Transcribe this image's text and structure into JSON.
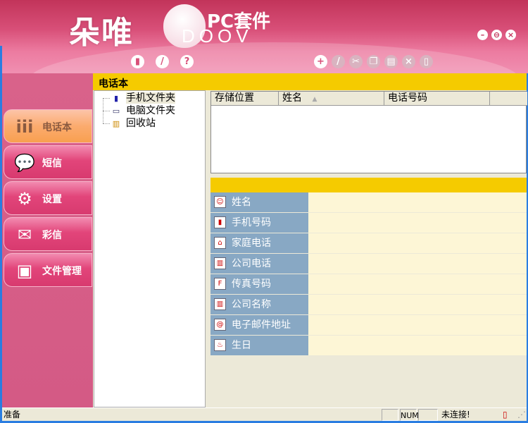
{
  "header": {
    "logo_cn": "朵唯",
    "logo_suffix": "PC套件",
    "logo_brand": "DOOV",
    "window_controls": [
      "minimize",
      "restore",
      "close"
    ],
    "toolbar_left": [
      {
        "icon": "new-icon",
        "glyph": "▮"
      },
      {
        "icon": "edit-icon",
        "glyph": "/"
      },
      {
        "icon": "help-icon",
        "glyph": "?"
      }
    ],
    "toolbar_right": [
      {
        "icon": "add-icon",
        "glyph": "+",
        "enabled": true
      },
      {
        "icon": "edit-icon",
        "glyph": "/",
        "enabled": false
      },
      {
        "icon": "cut-icon",
        "glyph": "✂",
        "enabled": false
      },
      {
        "icon": "copy-icon",
        "glyph": "❐",
        "enabled": false
      },
      {
        "icon": "paste-icon",
        "glyph": "▤",
        "enabled": false
      },
      {
        "icon": "delete-icon",
        "glyph": "×",
        "enabled": false
      },
      {
        "icon": "export-icon",
        "glyph": "▯",
        "enabled": false
      }
    ]
  },
  "sidebar": {
    "items": [
      {
        "label": "电话本",
        "icon": "contacts-icon",
        "glyph": "iii",
        "active": true
      },
      {
        "label": "短信",
        "icon": "sms-icon",
        "glyph": "💬"
      },
      {
        "label": "设置",
        "icon": "settings-icon",
        "glyph": "⚙"
      },
      {
        "label": "彩信",
        "icon": "mms-icon",
        "glyph": "✉"
      },
      {
        "label": "文件管理",
        "icon": "file-manager-icon",
        "glyph": "▣"
      }
    ]
  },
  "panel_title": "电话本",
  "tree": [
    {
      "label": "手机文件夹",
      "icon": "phone-icon",
      "glyph": "▮",
      "selected": true
    },
    {
      "label": "电脑文件夹",
      "icon": "computer-icon",
      "glyph": "▭"
    },
    {
      "label": "回收站",
      "icon": "recycle-bin-icon",
      "glyph": "▥"
    }
  ],
  "list": {
    "columns": [
      "存储位置",
      "姓名",
      "电话号码"
    ],
    "sort_indicator": "▲",
    "rows": []
  },
  "detail_fields": [
    {
      "label": "姓名",
      "icon": "name-icon",
      "glyph": "☺"
    },
    {
      "label": "手机号码",
      "icon": "mobile-icon",
      "glyph": "▮"
    },
    {
      "label": "家庭电话",
      "icon": "home-phone-icon",
      "glyph": "⌂"
    },
    {
      "label": "公司电话",
      "icon": "office-phone-icon",
      "glyph": "▥"
    },
    {
      "label": "传真号码",
      "icon": "fax-icon",
      "glyph": "F"
    },
    {
      "label": "公司名称",
      "icon": "company-icon",
      "glyph": "▥"
    },
    {
      "label": "电子邮件地址",
      "icon": "email-icon",
      "glyph": "@"
    },
    {
      "label": "生日",
      "icon": "birthday-icon",
      "glyph": "♨"
    }
  ],
  "status": {
    "text": "准备",
    "num": "NUM",
    "connection": "未连接!"
  }
}
